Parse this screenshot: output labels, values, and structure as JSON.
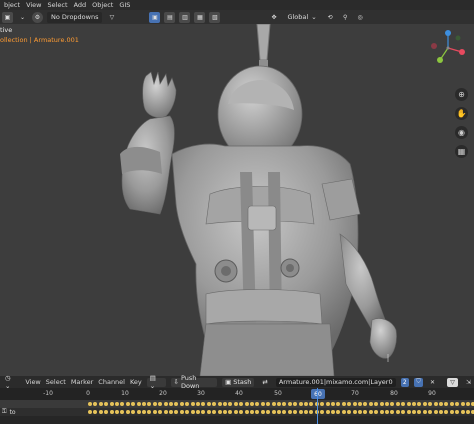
{
  "header": {
    "partial_label": "bject",
    "menus": [
      "View",
      "Select",
      "Add",
      "Object",
      "GIS"
    ]
  },
  "toolbar": {
    "overlay_dropdown": "No Dropdowns",
    "orientation": "Global"
  },
  "viewport": {
    "mode_text": "tive",
    "collection_text": "ollection | Armature.001"
  },
  "timeline": {
    "menus": [
      "View",
      "Select",
      "Marker",
      "Channel",
      "Key"
    ],
    "push_down": "Push Down",
    "stash": "Stash",
    "action_name": "Armature.001|mixamo.com|Layer0",
    "users": "2",
    "ticks": [
      "-10",
      "0",
      "10",
      "20",
      "30",
      "40",
      "50",
      "60",
      "70",
      "80",
      "90"
    ],
    "current_frame": "60",
    "tracks": [
      {
        "name": ""
      },
      {
        "name": "to"
      }
    ]
  },
  "colors": {
    "accent": "#4772b3",
    "keyframe": "#e6c35a",
    "axis_x": "#e84a5f",
    "axis_y": "#8cc63f",
    "axis_z": "#3d8fe0"
  }
}
